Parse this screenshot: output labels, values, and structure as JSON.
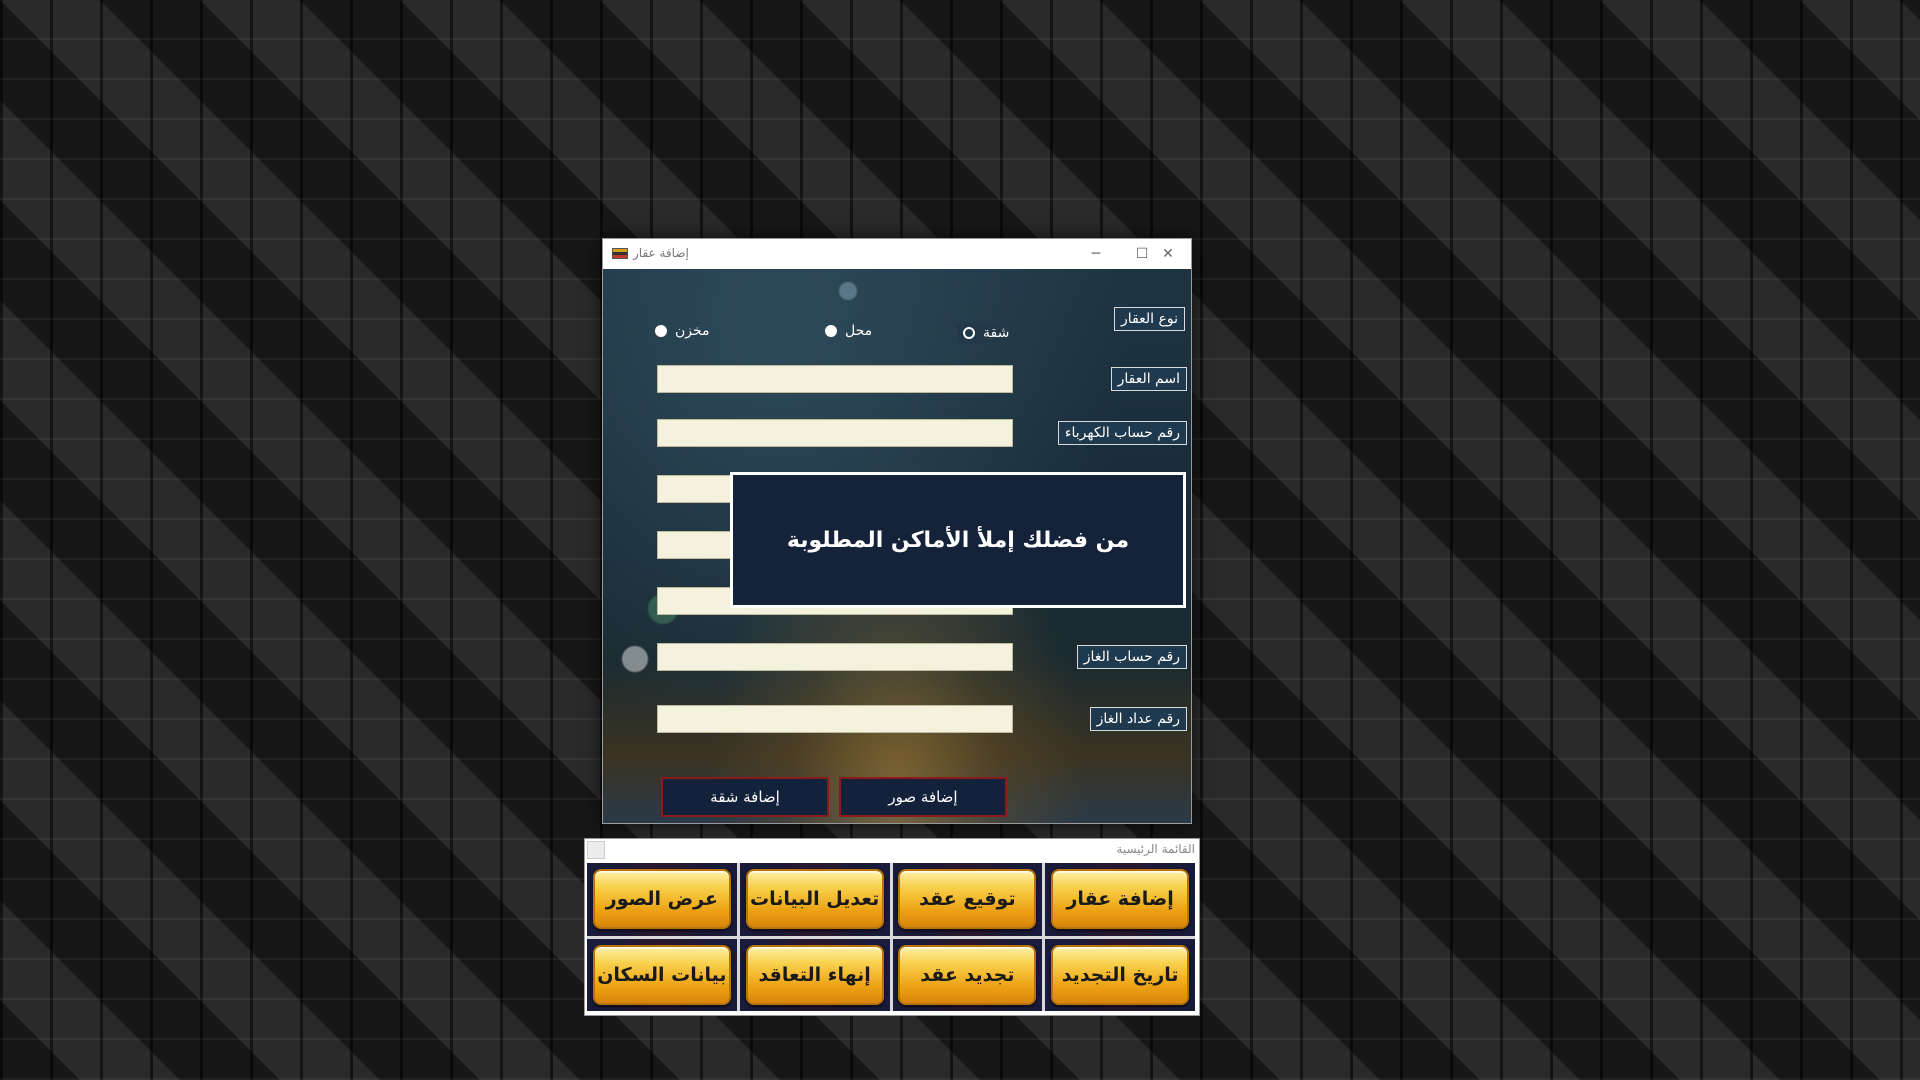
{
  "property_window": {
    "title": "إضافة عقار",
    "controls": {
      "minimize": "─",
      "maximize": "☐",
      "close": "✕"
    },
    "property_type_label": "نوع العقار",
    "property_type_options": [
      {
        "label": "شقة",
        "selected": true
      },
      {
        "label": "محل",
        "selected": false
      },
      {
        "label": "مخزن",
        "selected": false
      }
    ],
    "fields": [
      {
        "label": "اسم العقار",
        "value": ""
      },
      {
        "label": "رقم حساب الكهرباء",
        "value": ""
      },
      {
        "label": "",
        "value": ""
      },
      {
        "label": "",
        "value": ""
      },
      {
        "label": "",
        "value": ""
      },
      {
        "label": "رقم حساب الغاز",
        "value": ""
      },
      {
        "label": "رقم عداد الغاز",
        "value": ""
      }
    ],
    "add_apartment_button": "إضافة شقة",
    "add_photos_button": "إضافة صور"
  },
  "message_box": {
    "text": "من فضلك إملأ الأماكن المطلوبة"
  },
  "main_menu": {
    "title": "القائمة الرئيسية",
    "buttons_row1": [
      "إضافة عقار",
      "توقيع عقد",
      "تعديل البيانات",
      "عرض الصور"
    ],
    "buttons_row2": [
      "تاريخ التجديد",
      "تجديد عقد",
      "إنهاء التعاقد",
      "بيانات السكان"
    ]
  },
  "colors": {
    "field_bg": "#f4f1dc",
    "label_bg": "#1f3a4e",
    "action_border": "#8b1a1a",
    "gold_button": "#f8cf4a"
  }
}
